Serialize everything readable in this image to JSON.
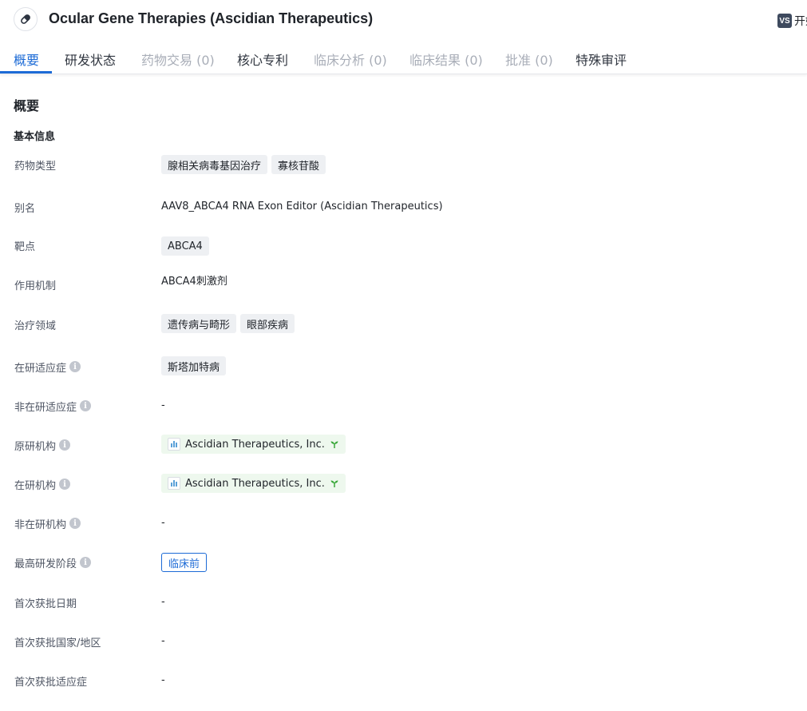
{
  "header": {
    "title": "Ocular Gene Therapies (Ascidian Therapeutics)",
    "icon": "pill-icon",
    "right_badge": "VS",
    "right_label": "开始"
  },
  "tabs": [
    {
      "label": "概要",
      "state": "active"
    },
    {
      "label": "研发状态",
      "state": "normal"
    },
    {
      "label": "药物交易 (0)",
      "state": "disabled"
    },
    {
      "label": "核心专利",
      "state": "normal"
    },
    {
      "label": "临床分析 (0)",
      "state": "disabled"
    },
    {
      "label": "临床结果 (0)",
      "state": "disabled"
    },
    {
      "label": "批准 (0)",
      "state": "disabled"
    },
    {
      "label": "特殊审评",
      "state": "normal"
    }
  ],
  "overview": {
    "section_title": "概要",
    "basic_info_title": "基本信息",
    "rows": {
      "drug_type": {
        "label": "药物类型",
        "tags": [
          "腺相关病毒基因治疗",
          "寡核苷酸"
        ]
      },
      "alias": {
        "label": "别名",
        "value": "AAV8_ABCA4 RNA Exon Editor (Ascidian Therapeutics)"
      },
      "target": {
        "label": "靶点",
        "tags": [
          "ABCA4"
        ]
      },
      "mechanism": {
        "label": "作用机制",
        "value": "ABCA4刺激剂"
      },
      "therapeutic_area": {
        "label": "治疗领域",
        "tags": [
          "遗传病与畸形",
          "眼部疾病"
        ]
      },
      "active_indication": {
        "label": "在研适应症",
        "tags": [
          "斯塔加特病"
        ]
      },
      "inactive_indication": {
        "label": "非在研适应症",
        "value": "-"
      },
      "originator": {
        "label": "原研机构",
        "org": "Ascidian Therapeutics, Inc."
      },
      "active_org": {
        "label": "在研机构",
        "org": "Ascidian Therapeutics, Inc."
      },
      "inactive_org": {
        "label": "非在研机构",
        "value": "-"
      },
      "highest_phase": {
        "label": "最高研发阶段",
        "phase": "临床前"
      },
      "first_approval_date": {
        "label": "首次获批日期",
        "value": "-"
      },
      "first_approval_country": {
        "label": "首次获批国家/地区",
        "value": "-"
      },
      "first_approval_indication": {
        "label": "首次获批适应症",
        "value": "-"
      }
    }
  },
  "colors": {
    "accent": "#1d6bd6",
    "tag_bg": "#eef0f3",
    "org_tag_bg": "#eef8ee",
    "sprout_green": "#3aa83a"
  }
}
